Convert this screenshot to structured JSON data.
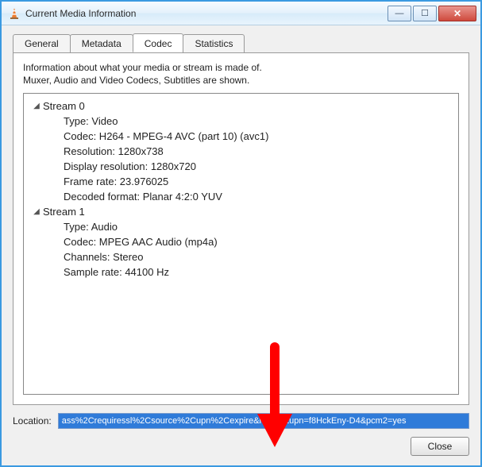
{
  "window": {
    "title": "Current Media Information"
  },
  "tabs": {
    "general": "General",
    "metadata": "Metadata",
    "codec": "Codec",
    "statistics": "Statistics"
  },
  "codec_tab": {
    "desc_line1": "Information about what your media or stream is made of.",
    "desc_line2": "Muxer, Audio and Video Codecs, Subtitles are shown.",
    "streams": [
      {
        "header": "Stream 0",
        "props": [
          "Type: Video",
          "Codec: H264 - MPEG-4 AVC (part 10) (avc1)",
          "Resolution: 1280x738",
          "Display resolution: 1280x720",
          "Frame rate: 23.976025",
          "Decoded format: Planar 4:2:0 YUV"
        ]
      },
      {
        "header": "Stream 1",
        "props": [
          "Type: Audio",
          "Codec: MPEG AAC Audio (mp4a)",
          "Channels: Stereo",
          "Sample rate: 44100 Hz"
        ]
      }
    ]
  },
  "location": {
    "label": "Location:",
    "value": "ass%2Crequiressl%2Csource%2Cupn%2Cexpire&mv=m&upn=f8HckEny-D4&pcm2=yes"
  },
  "buttons": {
    "close": "Close"
  }
}
